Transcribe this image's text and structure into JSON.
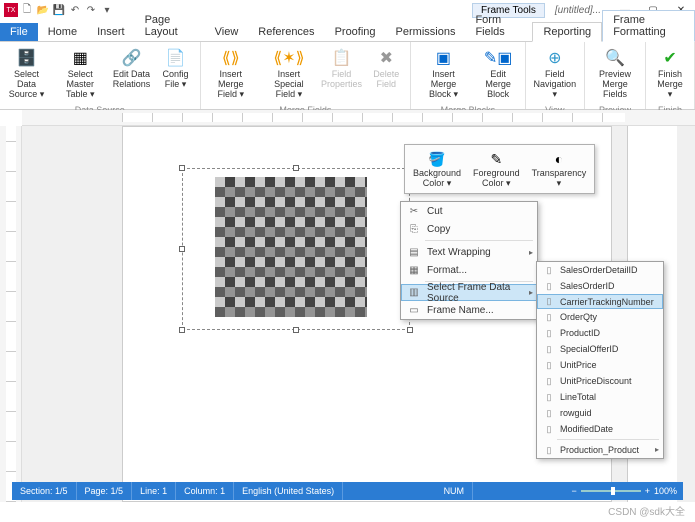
{
  "title": {
    "frameTools": "Frame Tools",
    "doc": "[untitled]..."
  },
  "tabs": {
    "file": "File",
    "home": "Home",
    "insert": "Insert",
    "pageLayout": "Page Layout",
    "view": "View",
    "references": "References",
    "proofing": "Proofing",
    "permissions": "Permissions",
    "formFields": "Form Fields",
    "reporting": "Reporting",
    "frameFormatting": "Frame Formatting"
  },
  "ribbon": {
    "groups": {
      "dataSource": "Data Source",
      "mergeFields": "Merge Fields",
      "mergeBlocks": "Merge Blocks",
      "view": "View",
      "preview": "Preview",
      "finish": "Finish"
    },
    "btns": {
      "selectDataSource": "Select Data\nSource ▾",
      "selectMasterTable": "Select\nMaster Table ▾",
      "editDataRelations": "Edit Data\nRelations",
      "configFile": "Config\nFile ▾",
      "insertMergeField": "Insert\nMerge Field ▾",
      "insertSpecialField": "Insert\nSpecial Field ▾",
      "fieldProperties": "Field\nProperties",
      "deleteField": "Delete\nField",
      "insertMergeBlock": "Insert\nMerge Block ▾",
      "editMergeBlock": "Edit Merge\nBlock",
      "fieldNavigation": "Field\nNavigation ▾",
      "previewMergeFields": "Preview\nMerge Fields",
      "finishMerge": "Finish\nMerge ▾"
    }
  },
  "miniToolbar": {
    "bgColor": "Background\nColor ▾",
    "fgColor": "Foreground\nColor ▾",
    "transparency": "Transparency\n▾"
  },
  "contextMenu": {
    "cut": "Cut",
    "copy": "Copy",
    "textWrapping": "Text Wrapping",
    "format": "Format...",
    "selectFrameDataSource": "Select Frame Data Source",
    "frameName": "Frame Name..."
  },
  "subMenu": [
    "SalesOrderDetailID",
    "SalesOrderID",
    "CarrierTrackingNumber",
    "OrderQty",
    "ProductID",
    "SpecialOfferID",
    "UnitPrice",
    "UnitPriceDiscount",
    "LineTotal",
    "rowguid",
    "ModifiedDate",
    "Production_Product"
  ],
  "subMenuHighlight": "CarrierTrackingNumber",
  "status": {
    "section": "Section: 1/5",
    "page": "Page: 1/5",
    "line": "Line: 1",
    "column": "Column: 1",
    "lang": "English (United States)",
    "num": "NUM",
    "zoom": "100%"
  },
  "watermark": "CSDN @sdk大全"
}
